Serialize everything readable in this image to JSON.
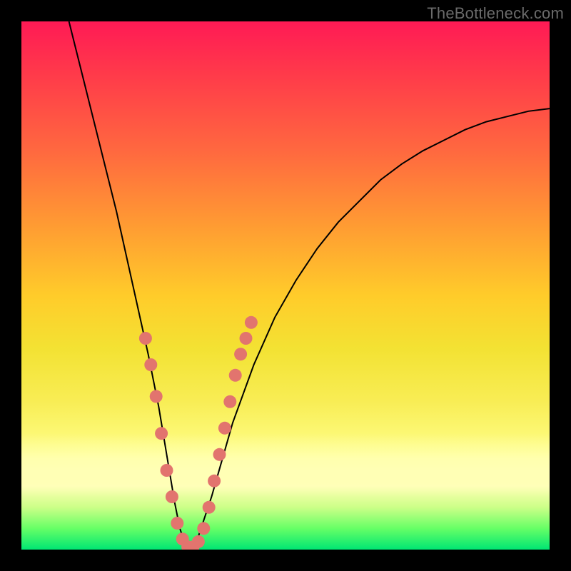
{
  "watermark": "TheBottleneck.com",
  "chart_data": {
    "type": "line",
    "title": "",
    "xlabel": "",
    "ylabel": "",
    "xlim": [
      0,
      100
    ],
    "ylim": [
      0,
      100
    ],
    "series": [
      {
        "name": "bottleneck-curve",
        "x": [
          9,
          10,
          12,
          14,
          16,
          18,
          20,
          22,
          24,
          26,
          27,
          28,
          29,
          30,
          31,
          32,
          33,
          34,
          36,
          38,
          40,
          44,
          48,
          52,
          56,
          60,
          64,
          68,
          72,
          76,
          80,
          84,
          88,
          92,
          96,
          100
        ],
        "values": [
          100,
          96,
          88,
          80,
          72,
          64,
          55,
          46,
          37,
          27,
          21,
          15,
          9,
          4,
          1,
          0,
          1,
          4,
          10,
          17,
          24,
          35,
          44,
          51,
          57,
          62,
          66,
          70,
          73,
          75.5,
          77.5,
          79.5,
          81,
          82,
          83,
          83.5
        ]
      }
    ],
    "dots": [
      {
        "x": 23.5,
        "y": 40
      },
      {
        "x": 24.5,
        "y": 35
      },
      {
        "x": 25.5,
        "y": 29
      },
      {
        "x": 26.5,
        "y": 22
      },
      {
        "x": 27.5,
        "y": 15
      },
      {
        "x": 28.5,
        "y": 10
      },
      {
        "x": 29.5,
        "y": 5
      },
      {
        "x": 30.5,
        "y": 2
      },
      {
        "x": 31.5,
        "y": 0.5
      },
      {
        "x": 32.5,
        "y": 0.5
      },
      {
        "x": 33.5,
        "y": 1.5
      },
      {
        "x": 34.5,
        "y": 4
      },
      {
        "x": 35.5,
        "y": 8
      },
      {
        "x": 36.5,
        "y": 13
      },
      {
        "x": 37.5,
        "y": 18
      },
      {
        "x": 38.5,
        "y": 23
      },
      {
        "x": 39.5,
        "y": 28
      },
      {
        "x": 40.5,
        "y": 33
      },
      {
        "x": 41.5,
        "y": 37
      },
      {
        "x": 42.5,
        "y": 40
      },
      {
        "x": 43.5,
        "y": 43
      }
    ],
    "gradient_stops": [
      {
        "pos": 0,
        "color": "#ff1a55"
      },
      {
        "pos": 25,
        "color": "#ff9933"
      },
      {
        "pos": 55,
        "color": "#ffdd33"
      },
      {
        "pos": 82,
        "color": "#ffff99"
      },
      {
        "pos": 100,
        "color": "#00e673"
      }
    ]
  }
}
